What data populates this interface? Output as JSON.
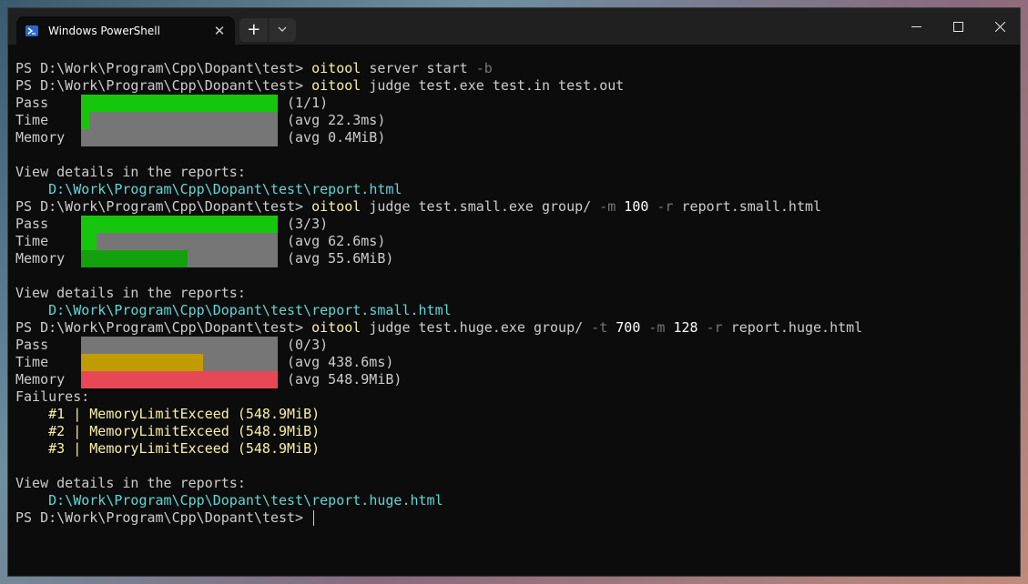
{
  "window": {
    "tab_title": "Windows PowerShell",
    "tab_close": "✕",
    "new_tab": "+",
    "dropdown": "⌄",
    "minimize": "—",
    "maximize": "☐",
    "close": "✕"
  },
  "colors": {
    "background": "#0c0c0c",
    "text": "#cccccc",
    "command": "#f9f1a5",
    "path": "#61d6d6",
    "bar_bg": "#767676",
    "pass_green": "#16c60c",
    "dark_green": "#13a10e",
    "time_yellow": "#c19c00",
    "mem_red": "#e74856"
  },
  "prompt": "PS D:\\Work\\Program\\Cpp\\Dopant\\test> ",
  "runs": {
    "r0": {
      "cmd": "oitool",
      "args": " server start ",
      "flag": "-b"
    },
    "r1": {
      "cmd": "oitool",
      "args": " judge test.exe test.in test.out",
      "pass": {
        "label": "Pass",
        "value": "(1/1)",
        "fraction": 1.0
      },
      "time": {
        "label": "Time",
        "value": "(avg 22.3ms)",
        "fraction": 0.04
      },
      "memory": {
        "label": "Memory",
        "value": "(avg 0.4MiB)",
        "fraction": 0.0
      },
      "details_label": "View details in the reports:",
      "report": "    D:\\Work\\Program\\Cpp\\Dopant\\test\\report.html"
    },
    "r2": {
      "cmd": "oitool",
      "args1": " judge test.small.exe group/ ",
      "flag_m": "-m",
      "mval": " 100",
      "flag_r": " -r",
      "args2": " report.small.html",
      "pass": {
        "label": "Pass",
        "value": "(3/3)",
        "fraction": 1.0
      },
      "time": {
        "label": "Time",
        "value": "(avg 62.6ms)",
        "fraction": 0.08
      },
      "memory": {
        "label": "Memory",
        "value": "(avg 55.6MiB)",
        "fraction": 0.54
      },
      "details_label": "View details in the reports:",
      "report": "    D:\\Work\\Program\\Cpp\\Dopant\\test\\report.small.html"
    },
    "r3": {
      "cmd": "oitool",
      "args1": " judge test.huge.exe group/ ",
      "flag_t": "-t",
      "tval": " 700",
      "flag_m": " -m",
      "mval": " 128",
      "flag_r": " -r",
      "args2": " report.huge.html",
      "pass": {
        "label": "Pass",
        "value": "(0/3)",
        "fraction": 0.0
      },
      "time": {
        "label": "Time",
        "value": "(avg 438.6ms)",
        "fraction": 0.62
      },
      "memory": {
        "label": "Memory",
        "value": "(avg 548.9MiB)",
        "fraction": 1.0
      },
      "failures_label": "Failures:",
      "failures": [
        "    #1 | MemoryLimitExceed (548.9MiB)",
        "    #2 | MemoryLimitExceed (548.9MiB)",
        "    #3 | MemoryLimitExceed (548.9MiB)"
      ],
      "details_label": "View details in the reports:",
      "report": "    D:\\Work\\Program\\Cpp\\Dopant\\test\\report.huge.html"
    }
  }
}
